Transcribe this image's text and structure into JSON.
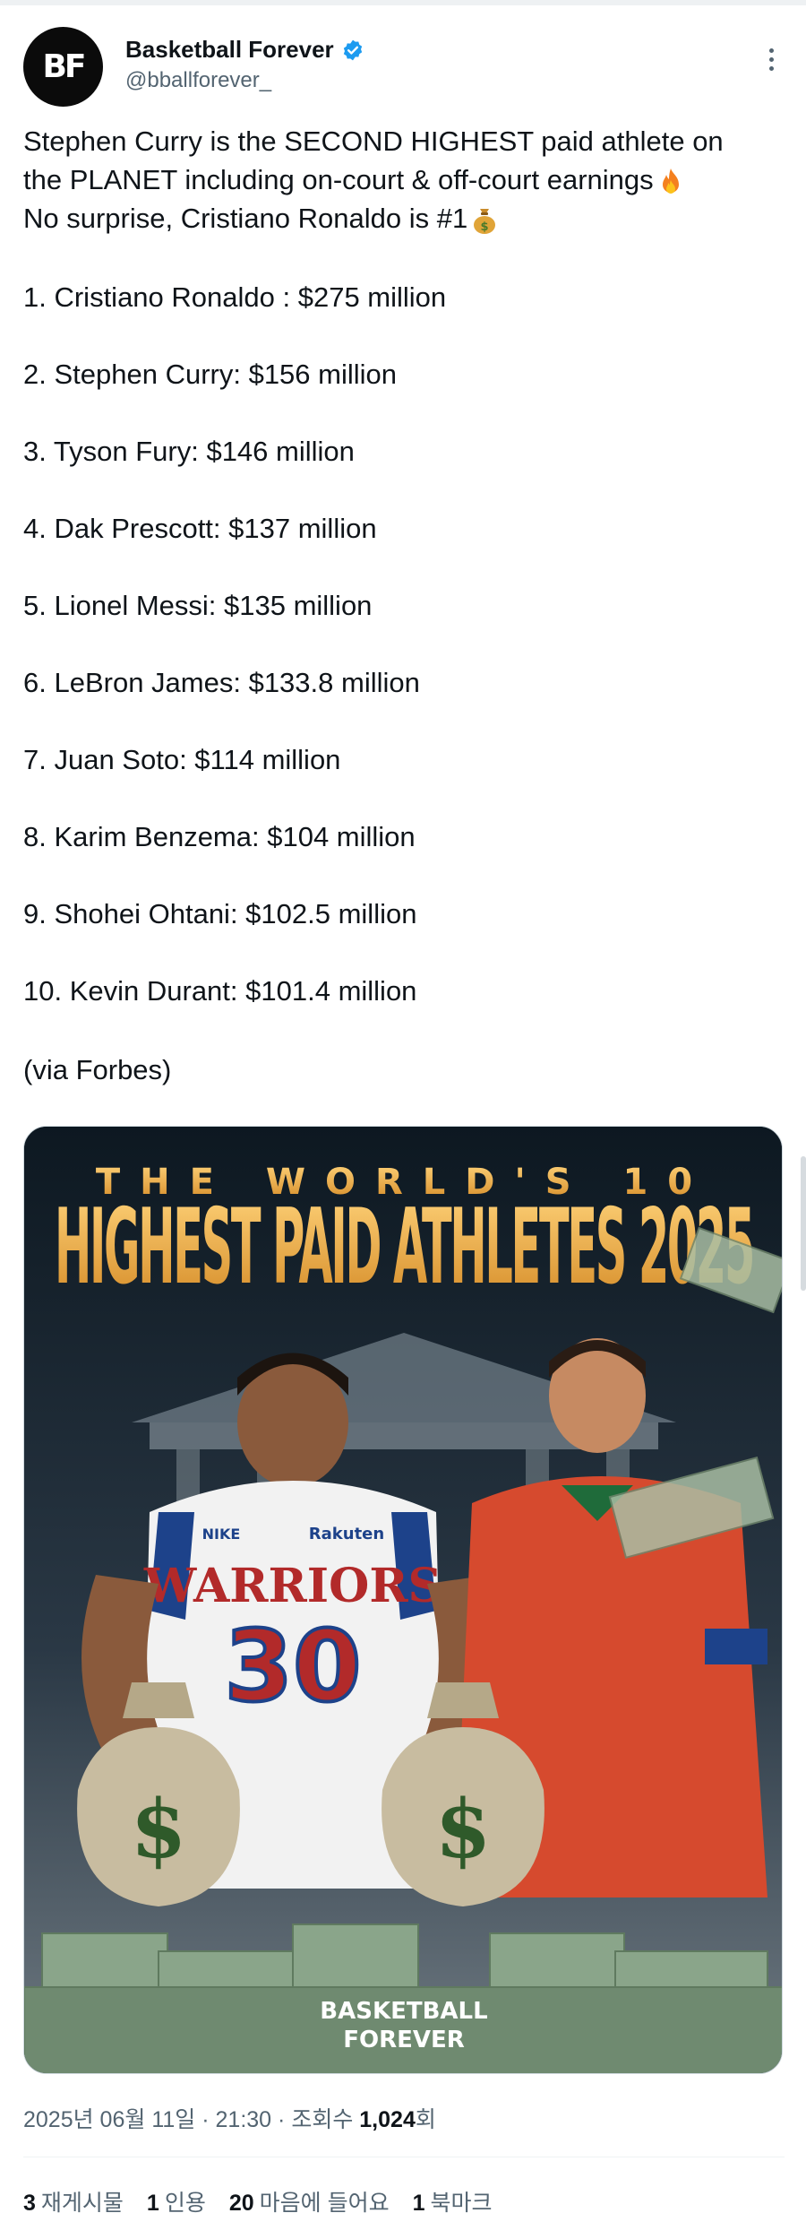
{
  "author": {
    "avatar_text": "BF",
    "display_name": "Basketball Forever",
    "handle": "@bballforever_"
  },
  "tweet": {
    "lines": [
      "Stephen Curry is the SECOND HIGHEST paid athlete on",
      "the PLANET including on-court & off-court earnings",
      "No surprise, Cristiano Ronaldo is #1"
    ],
    "fire_emoji": "fire-emoji",
    "moneybag_emoji": "money-bag-emoji",
    "rankings": [
      "1. Cristiano Ronaldo : $275 million",
      "2. Stephen Curry: $156 million",
      "3. Tyson Fury: $146 million",
      "4. Dak Prescott: $137 million",
      "5. Lionel Messi: $135 million",
      "6. LeBron James: $133.8 million",
      "7. Juan Soto: $114 million",
      "8. Karim Benzema: $104 million",
      "9. Shohei Ohtani: $102.5 million",
      "10. Kevin Durant: $101.4 million"
    ],
    "source": "(via Forbes)"
  },
  "media": {
    "headline_top": "THE WORLD'S 10",
    "headline_main": "HIGHEST PAID ATHLETES 2025",
    "jersey_team": "WARRIORS",
    "jersey_number": "30",
    "jersey_sponsor": "Rakuten",
    "jersey_brand": "NIKE",
    "bag_symbol": "$",
    "watermark_line1": "BASKETBALL",
    "watermark_line2": "FOREVER"
  },
  "meta": {
    "date": "2025년 06월 11일",
    "time": "21:30",
    "views_label": "조회수",
    "views_count": "1,024",
    "views_suffix": "회",
    "separator": "·"
  },
  "stats": {
    "reposts_count": "3",
    "reposts_label": "재게시물",
    "quotes_count": "1",
    "quotes_label": "인용",
    "likes_count": "20",
    "likes_label": "마음에 들어요",
    "bookmarks_count": "1",
    "bookmarks_label": "북마크"
  },
  "colors": {
    "verified_blue": "#1d9bf0",
    "headline_gold": "#e8a43c",
    "warriors_white": "#f2f2f2",
    "ronaldo_red": "#d64a2e"
  }
}
